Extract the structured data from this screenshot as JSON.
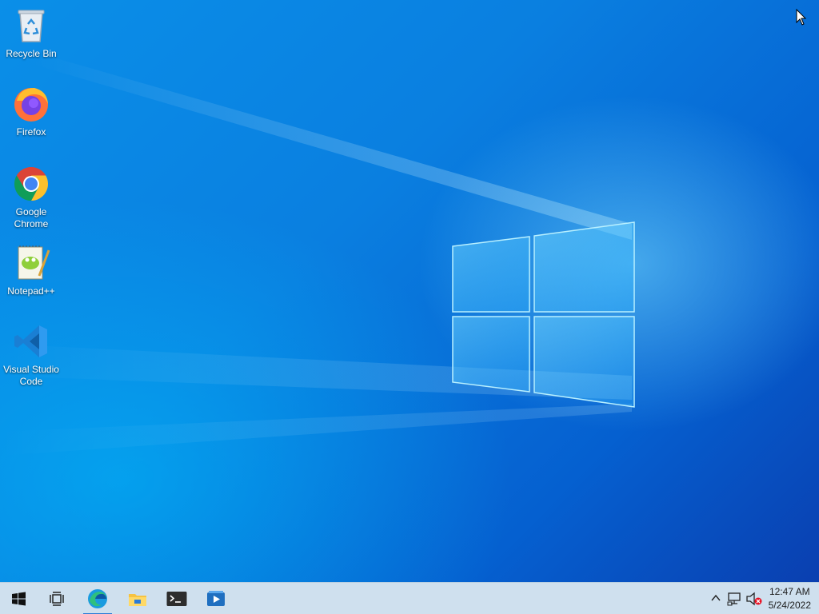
{
  "desktop": {
    "icons": [
      {
        "label": "Recycle Bin",
        "icon": "recycle-bin-icon"
      },
      {
        "label": "Firefox",
        "icon": "firefox-icon"
      },
      {
        "label_line1": "Google",
        "label_line2": "Chrome",
        "icon": "chrome-icon"
      },
      {
        "label": "Notepad++",
        "icon": "notepadpp-icon"
      },
      {
        "label_line1": "Visual Studio",
        "label_line2": "Code",
        "icon": "vscode-icon"
      }
    ],
    "wallpaper_colors": {
      "light": "#7fd8ff",
      "mid": "#0a8fe8",
      "dark": "#0a3fb0"
    }
  },
  "taskbar": {
    "background": "#cfe0ee",
    "pinned": [
      "start-icon",
      "task-view-icon",
      "edge-icon",
      "file-explorer-icon",
      "terminal-icon",
      "media-player-icon"
    ],
    "active_app": "edge-icon",
    "tray": {
      "icons": [
        "chevron-up-icon",
        "network-icon",
        "volume-muted-icon"
      ],
      "time": "12:47 AM",
      "date": "5/24/2022"
    }
  }
}
